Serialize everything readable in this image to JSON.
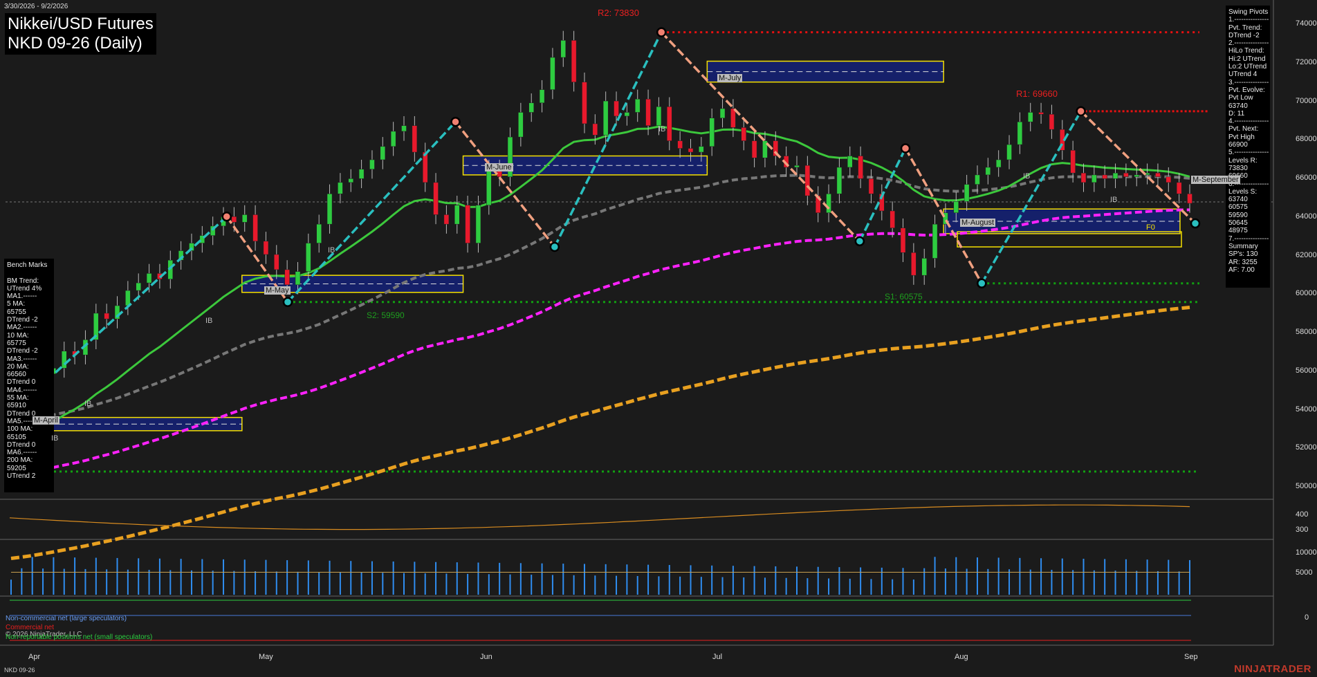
{
  "header": {
    "date_range": "3/30/2026 - 9/2/2026",
    "title_line1": "Nikkei/USD Futures",
    "title_line2": "NKD 09-26 (Daily)"
  },
  "swing_pivots": {
    "text": "Swing Pivots\n1.---------------\nPvt. Trend:\nDTrend -2\n2.---------------\nHiLo Trend:\nHi:2 UTrend\nLo:2 UTrend\nUTrend 4\n3.---------------\nPvt. Evolve:\nPvt Low\n63740\nD: 11\n4.---------------\nPvt. Next:\nPvt High\n66900\n5.---------------\nLevels R:\n73830\n69660\n6.---------------\nLevels S:\n63740\n60575\n59590\n50645\n48975\n7.---------------\nSummary\nSP's: 130\nAR: 3255\nAF: 7.00"
  },
  "bench_marks": {
    "text": "Bench Marks\n\nBM Trend:\nUTrend 4%\nMA1.------\n5 MA:\n65755\nDTrend -2\nMA2.------\n10 MA:\n65775\nDTrend -2\nMA3.------\n20 MA:\n66560\nDTrend 0\nMA4.------\n55 MA:\n65910\nDTrend 0\nMA5.------\n100 MA:\n65105\nDTrend 0\nMA6.------\n200 MA:\n59205\nUTrend 2"
  },
  "levels": {
    "r2": "R2: 73830",
    "r1": "R1: 69660",
    "s1": "S1: 60575",
    "s2": "S2: 59590",
    "f0": "F0"
  },
  "boxes": {
    "april": "M-April",
    "may": "M-May",
    "june": "M-June",
    "july": "M-July",
    "august": "M-August",
    "september": "M-September"
  },
  "ib_label": "IB",
  "price_axis": [
    "74000",
    "72000",
    "70000",
    "68000",
    "66000",
    "64000",
    "62000",
    "60000",
    "58000",
    "56000",
    "54000",
    "52000",
    "50000"
  ],
  "osc_axis": [
    "400",
    "300"
  ],
  "vol_axis": [
    "10000",
    "5000"
  ],
  "cot_axis": [
    "0"
  ],
  "x_axis": [
    "Apr",
    "May",
    "Jun",
    "Jul",
    "Aug",
    "Sep"
  ],
  "legend": {
    "noncommercial": "Non-commercial net (large speculators)",
    "commercial": "Commercial net",
    "small": "Non-reportable positions net (small speculators)",
    "copyright": "© 2026 NinjaTrader, LLC"
  },
  "footer": {
    "symbol": "NKD 09-26",
    "brand": "NINJATRADER"
  },
  "colors": {
    "up": "#2ecc40",
    "down": "#e8192c",
    "ma_green": "#3cc83c",
    "ma_grey": "#777777",
    "ma_magenta": "#ff22ff",
    "ma_orange": "#e8a020",
    "swing_up": "#2abfbf",
    "swing_down": "#f0a080",
    "box_fill": "#15206a",
    "box_border": "#f5e000",
    "resistance": "#e81010",
    "support": "#11a011"
  },
  "chart_data": {
    "type": "candlestick",
    "xlim": [
      "2026-03-30",
      "2026-09-02"
    ],
    "ylim": [
      49400,
      74800
    ],
    "closes": [
      52200,
      53000,
      54200,
      55800,
      56100,
      57000,
      56800,
      57600,
      59000,
      58700,
      59400,
      60200,
      60600,
      61100,
      60800,
      61800,
      62300,
      62700,
      63100,
      63600,
      64100,
      63800,
      64200,
      62800,
      62100,
      61300,
      60500,
      61200,
      62700,
      63700,
      65300,
      65900,
      66100,
      66600,
      67100,
      67800,
      68600,
      68900,
      67500,
      65900,
      64200,
      63700,
      64700,
      62700,
      64700,
      66600,
      66200,
      68300,
      69600,
      70100,
      70800,
      72500,
      73400,
      71200,
      69000,
      68400,
      70200,
      69400,
      69600,
      70300,
      68900,
      69900,
      68100,
      67700,
      67500,
      67800,
      69300,
      69800,
      68800,
      68100,
      67200,
      68100,
      67300,
      66700,
      66800,
      65200,
      64300,
      65300,
      66700,
      67300,
      66100,
      65300,
      64400,
      63500,
      62200,
      61000,
      61900,
      63700,
      64300,
      64900,
      65800,
      66300,
      66700,
      67100,
      67900,
      69100,
      69600,
      69500,
      68700,
      67600,
      66400,
      65900,
      66300,
      66100,
      66400,
      66200,
      66300,
      66400,
      66200,
      65900,
      65300,
      64800
    ],
    "levels": {
      "R2": 73830,
      "R1": 69660,
      "S1": 60575,
      "S2": 59590,
      "S3": 50645
    },
    "moving_averages": {
      "5 MA": 65755,
      "10 MA": 65775,
      "20 MA": 66560,
      "55 MA": 65910,
      "100 MA": 65105,
      "200 MA": 59205
    },
    "swing_pivots": [
      {
        "date": "2026-04-01",
        "price": 54200
      },
      {
        "date": "2026-04-28",
        "price": 64100
      },
      {
        "date": "2026-05-06",
        "price": 59590
      },
      {
        "date": "2026-05-28",
        "price": 69100
      },
      {
        "date": "2026-06-10",
        "price": 62500
      },
      {
        "date": "2026-06-24",
        "price": 73830
      },
      {
        "date": "2026-07-20",
        "price": 62800
      },
      {
        "date": "2026-07-26",
        "price": 67700
      },
      {
        "date": "2026-08-05",
        "price": 60575
      },
      {
        "date": "2026-08-18",
        "price": 69660
      },
      {
        "date": "2026-09-02",
        "price": 63740
      }
    ],
    "monthly_boxes": [
      {
        "name": "M-April",
        "from": "2026-03-30",
        "to": "2026-04-30",
        "high": 53500,
        "low": 52800
      },
      {
        "name": "M-May",
        "from": "2026-04-30",
        "to": "2026-05-29",
        "high": 61000,
        "low": 60100
      },
      {
        "name": "M-June",
        "from": "2026-05-29",
        "to": "2026-06-30",
        "high": 67300,
        "low": 66300
      },
      {
        "name": "M-July",
        "from": "2026-06-30",
        "to": "2026-07-31",
        "high": 72300,
        "low": 71200
      },
      {
        "name": "M-August",
        "from": "2026-07-31",
        "to": "2026-08-31",
        "high": 64500,
        "low": 63200
      }
    ],
    "volume_axis": [
      0,
      12000
    ],
    "oscillator_axis": [
      180,
      520
    ]
  }
}
